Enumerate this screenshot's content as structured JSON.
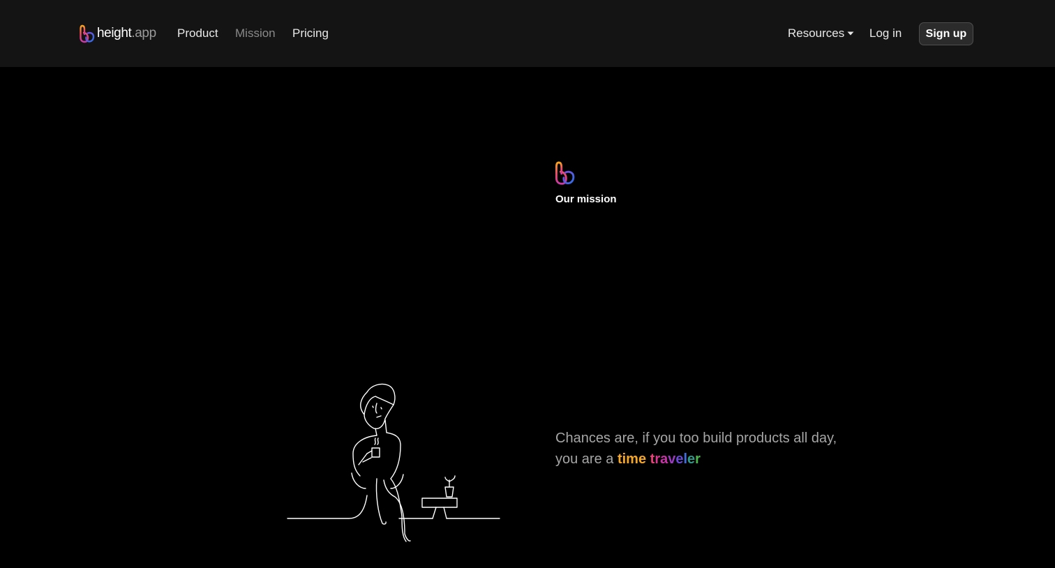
{
  "nav": {
    "brand": {
      "name": "height",
      "tld": ".app"
    },
    "links": [
      {
        "label": "Product"
      },
      {
        "label": "Mission"
      },
      {
        "label": "Pricing"
      }
    ],
    "resources_label": "Resources",
    "login_label": "Log in",
    "signup_label": "Sign up"
  },
  "hero": {
    "section_label": "Our mission",
    "tagline_line1": "Chances are, if you too build products all day,",
    "tagline_line2_prefix": "you are a",
    "highlight_word1": "time",
    "highlight_word2_letters": [
      "t",
      "r",
      "a",
      "v",
      "e",
      "l",
      "e",
      "r"
    ]
  },
  "colors": {
    "nav_background": "#141414",
    "page_background": "#000000",
    "gradient_time": "#f5a623",
    "gradient_traveler": [
      "#e8427a",
      "#d9368f",
      "#c832a8",
      "#9b3ac0",
      "#6a48d6",
      "#3f6ee0",
      "#2f9a8a",
      "#4bb84e"
    ]
  },
  "icons": {
    "brand": "height-logo-icon",
    "caret": "caret-down-icon",
    "illustration": "person-drinking-coffee-illustration"
  }
}
